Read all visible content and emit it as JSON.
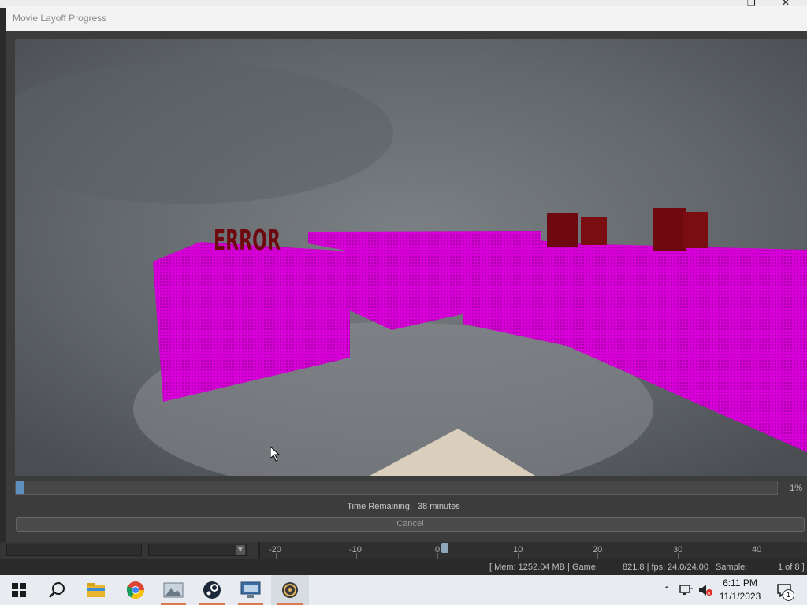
{
  "window": {
    "app_caption": "Movie Layoff Progress"
  },
  "progress": {
    "fraction": 0.01,
    "percent_label": "1%",
    "time_label": "Time Remaining:",
    "time_value": "38 minutes",
    "cancel_label": "Cancel"
  },
  "viewport": {
    "text_sign": "ERROR",
    "colors": {
      "missing_texture": "#e000e0",
      "block": "#6e0a0f"
    }
  },
  "timeline": {
    "ticks": [
      "-20",
      "-10",
      "0",
      "10",
      "20",
      "30",
      "40"
    ]
  },
  "statusbar": {
    "mem": "[ Mem:  1252.04 MB | Game:",
    "game_value": "821.8 | fps:",
    "fps": "24.0/24.00 | Sample:",
    "sample": "1 of 8 ]"
  },
  "taskbar": {
    "apps": [
      "start-icon",
      "search-icon",
      "file-explorer-icon",
      "chrome-icon",
      "image-viewer-icon",
      "steam-icon",
      "remote-desktop-icon",
      "sfm-icon"
    ],
    "clock_time": "6:11 PM",
    "clock_date": "11/1/2023",
    "notification_count": "1",
    "accent": "#d77a4f"
  }
}
